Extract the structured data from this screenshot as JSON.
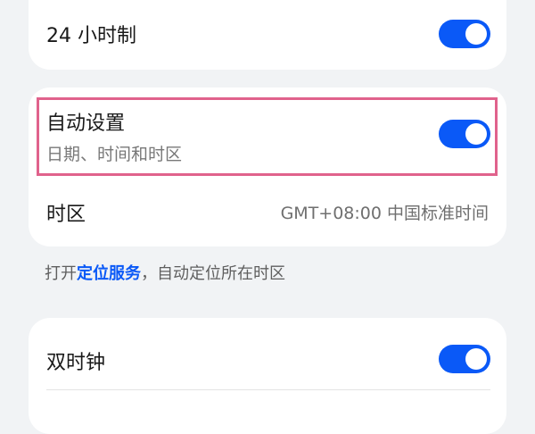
{
  "settings": {
    "hour24": {
      "label": "24 小时制",
      "enabled": true
    },
    "auto_set": {
      "label": "自动设置",
      "sublabel": "日期、时间和时区",
      "enabled": true
    },
    "timezone": {
      "label": "时区",
      "value": "GMT+08:00 中国标准时间"
    },
    "footnote": {
      "prefix": "打开",
      "link": "定位服务",
      "suffix": "，自动定位所在时区"
    },
    "dual_clock": {
      "label": "双时钟",
      "enabled": true
    }
  },
  "colors": {
    "accent": "#0a59f7",
    "highlight": "#e0628c",
    "background": "#f1f3f5",
    "card": "#ffffff"
  }
}
